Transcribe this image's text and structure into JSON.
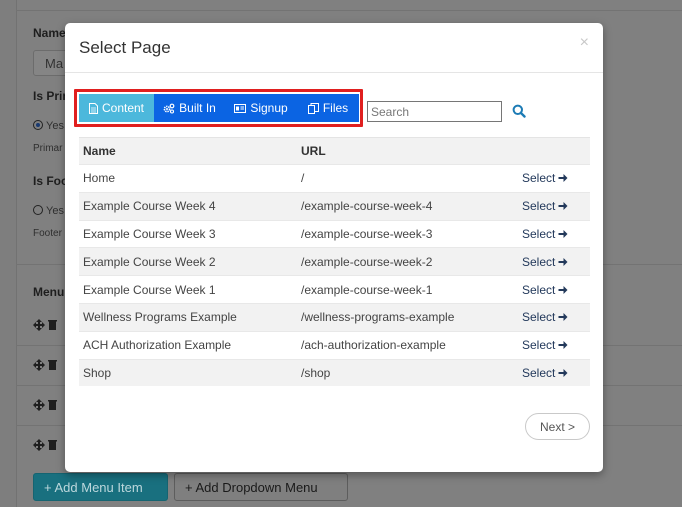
{
  "background": {
    "labels": [
      "Name",
      "Is Prim",
      "Is Foo",
      "Menu"
    ],
    "name_value": "Ma",
    "radio_primary_label": "Yes",
    "radio_primary_help": "Primar",
    "radio_footer_label": "Yes",
    "radio_footer_help": "Footer",
    "add_menu_item_label": "Add Menu Item",
    "add_dropdown_label": "Add Dropdown Menu",
    "colors": {
      "primary_button": "#19707f"
    }
  },
  "modal": {
    "title": "Select Page",
    "close_glyph": "×",
    "tabs": [
      {
        "label": "Content",
        "icon": "file-icon",
        "active": true
      },
      {
        "label": "Built In",
        "icon": "cogs-icon",
        "active": false
      },
      {
        "label": "Signup",
        "icon": "id-card-icon",
        "active": false
      },
      {
        "label": "Files",
        "icon": "copy-icon",
        "active": false
      }
    ],
    "search": {
      "placeholder": "Search",
      "value": ""
    },
    "table": {
      "headers": {
        "name": "Name",
        "url": "URL"
      },
      "select_label": "Select",
      "rows": [
        {
          "name": "Home",
          "url": "/"
        },
        {
          "name": "Example Course Week 4",
          "url": "/example-course-week-4"
        },
        {
          "name": "Example Course Week 3",
          "url": "/example-course-week-3"
        },
        {
          "name": "Example Course Week 2",
          "url": "/example-course-week-2"
        },
        {
          "name": "Example Course Week 1",
          "url": "/example-course-week-1"
        },
        {
          "name": "Wellness Programs Example",
          "url": "/wellness-programs-example"
        },
        {
          "name": "ACH Authorization Example",
          "url": "/ach-authorization-example"
        },
        {
          "name": "Shop",
          "url": "/shop"
        }
      ]
    },
    "next_label": "Next >",
    "colors": {
      "tab_active": "#4cb8dc",
      "tab": "#0b64e3",
      "highlight": "#e01f1f",
      "select_link": "#23395b",
      "search_icon": "#1c7bb5"
    }
  }
}
